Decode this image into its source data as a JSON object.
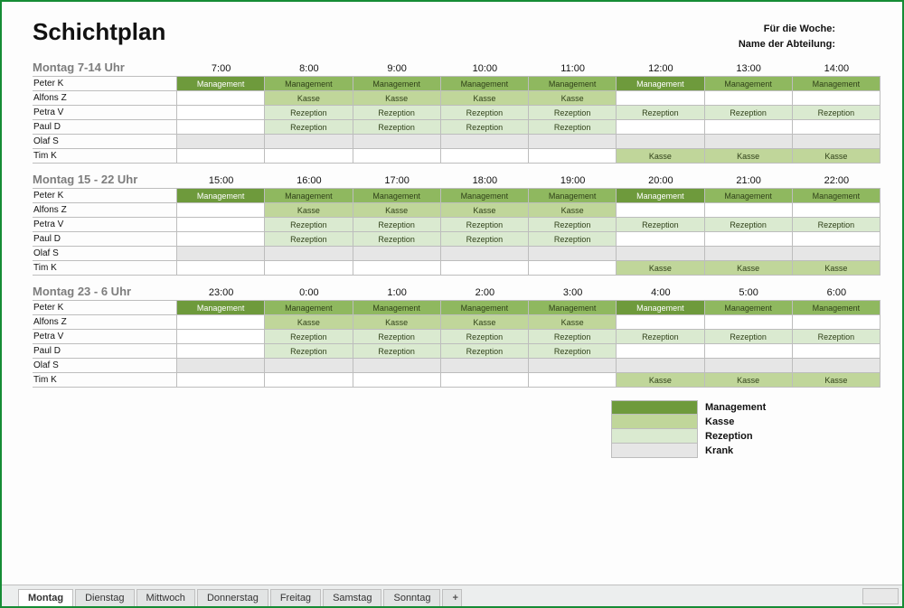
{
  "title": "Schichtplan",
  "meta": {
    "week": "Für die Woche:",
    "dept": "Name der Abteilung:"
  },
  "activities": {
    "M": "Management",
    "K": "Kasse",
    "R": "Rezeption",
    "Kr": "Krank"
  },
  "colors": {
    "management_dark": "#6e9a3c",
    "management_light": "#8fb85f",
    "kasse": "#c0d69a",
    "rezeption": "#daead0",
    "gray": "#e6e6e6"
  },
  "sections": [
    {
      "title": "Montag 7-14 Uhr",
      "times": [
        "7:00",
        "8:00",
        "9:00",
        "10:00",
        "11:00",
        "12:00",
        "13:00",
        "14:00"
      ],
      "rows": [
        {
          "name": "Peter K",
          "cells": [
            "M",
            "M2",
            "M2",
            "M2",
            "M2",
            "M",
            "M2",
            "M2"
          ]
        },
        {
          "name": "Alfons Z",
          "cells": [
            "",
            "K",
            "K",
            "K",
            "K",
            "",
            "",
            ""
          ]
        },
        {
          "name": "Petra V",
          "cells": [
            "",
            "R",
            "R",
            "R",
            "R",
            "R",
            "R",
            "R"
          ]
        },
        {
          "name": "Paul D",
          "cells": [
            "",
            "R",
            "R",
            "R",
            "R",
            "",
            "",
            ""
          ]
        },
        {
          "name": "Olaf S",
          "cells": [
            "G",
            "G",
            "G",
            "G",
            "G",
            "G",
            "G",
            "G"
          ]
        },
        {
          "name": "Tim K",
          "cells": [
            "",
            "",
            "",
            "",
            "",
            "K",
            "K",
            "K"
          ]
        }
      ]
    },
    {
      "title": "Montag 15 - 22 Uhr",
      "times": [
        "15:00",
        "16:00",
        "17:00",
        "18:00",
        "19:00",
        "20:00",
        "21:00",
        "22:00"
      ],
      "rows": [
        {
          "name": "Peter K",
          "cells": [
            "M",
            "M2",
            "M2",
            "M2",
            "M2",
            "M",
            "M2",
            "M2"
          ]
        },
        {
          "name": "Alfons Z",
          "cells": [
            "",
            "K",
            "K",
            "K",
            "K",
            "",
            "",
            ""
          ]
        },
        {
          "name": "Petra V",
          "cells": [
            "",
            "R",
            "R",
            "R",
            "R",
            "R",
            "R",
            "R"
          ]
        },
        {
          "name": "Paul D",
          "cells": [
            "",
            "R",
            "R",
            "R",
            "R",
            "",
            "",
            ""
          ]
        },
        {
          "name": "Olaf S",
          "cells": [
            "G",
            "G",
            "G",
            "G",
            "G",
            "G",
            "G",
            "G"
          ]
        },
        {
          "name": "Tim K",
          "cells": [
            "",
            "",
            "",
            "",
            "",
            "K",
            "K",
            "K"
          ]
        }
      ]
    },
    {
      "title": "Montag 23 - 6 Uhr",
      "times": [
        "23:00",
        "0:00",
        "1:00",
        "2:00",
        "3:00",
        "4:00",
        "5:00",
        "6:00"
      ],
      "rows": [
        {
          "name": "Peter K",
          "cells": [
            "M",
            "M2",
            "M2",
            "M2",
            "M2",
            "M",
            "M2",
            "M2"
          ]
        },
        {
          "name": "Alfons Z",
          "cells": [
            "",
            "K",
            "K",
            "K",
            "K",
            "",
            "",
            ""
          ]
        },
        {
          "name": "Petra V",
          "cells": [
            "",
            "R",
            "R",
            "R",
            "R",
            "R",
            "R",
            "R"
          ]
        },
        {
          "name": "Paul D",
          "cells": [
            "",
            "R",
            "R",
            "R",
            "R",
            "",
            "",
            ""
          ]
        },
        {
          "name": "Olaf S",
          "cells": [
            "G",
            "G",
            "G",
            "G",
            "G",
            "G",
            "G",
            "G"
          ]
        },
        {
          "name": "Tim K",
          "cells": [
            "",
            "",
            "",
            "",
            "",
            "K",
            "K",
            "K"
          ]
        }
      ]
    }
  ],
  "legend": [
    {
      "color": "management_dark",
      "label": "Management"
    },
    {
      "color": "kasse",
      "label": "Kasse"
    },
    {
      "color": "rezeption",
      "label": "Rezeption"
    },
    {
      "color": "gray",
      "label": "Krank"
    }
  ],
  "tabs": [
    "Montag",
    "Dienstag",
    "Mittwoch",
    "Donnerstag",
    "Freitag",
    "Samstag",
    "Sonntag"
  ],
  "active_tab": 0,
  "add_tab_glyph": "+"
}
